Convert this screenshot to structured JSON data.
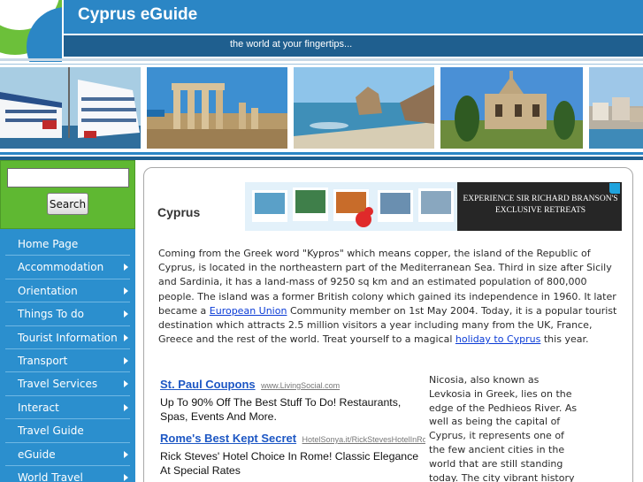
{
  "header": {
    "site_title": "Cyprus eGuide",
    "tagline": "the world at your fingertips..."
  },
  "photos": [
    {
      "subject": "cruise ships in harbour",
      "sky": "#a8cde3",
      "ground": "#2f6e9c"
    },
    {
      "subject": "ancient temple columns",
      "sky": "#3d8fd1",
      "ground": "#b79a6a"
    },
    {
      "subject": "rocky coast and sea",
      "sky": "#8ec4ea",
      "ground": "#3f8fb8"
    },
    {
      "subject": "abbey ruins with cypress trees",
      "sky": "#4a90d6",
      "ground": "#6c8b3c"
    },
    {
      "subject": "seaside town",
      "sky": "#9ec7e8",
      "ground": "#b8b0a2"
    }
  ],
  "sidebar": {
    "search": {
      "value": "",
      "placeholder": "",
      "button_label": "Search"
    },
    "nav": [
      {
        "label": "Home Page",
        "has_submenu": false
      },
      {
        "label": "Accommodation",
        "has_submenu": true
      },
      {
        "label": "Orientation",
        "has_submenu": true
      },
      {
        "label": "Things To do",
        "has_submenu": true
      },
      {
        "label": "Tourist Information",
        "has_submenu": true
      },
      {
        "label": "Transport",
        "has_submenu": true
      },
      {
        "label": "Travel Services",
        "has_submenu": true
      },
      {
        "label": "Interact",
        "has_submenu": true
      },
      {
        "label": "Travel Guide",
        "has_submenu": false
      },
      {
        "label": "eGuide",
        "has_submenu": true
      },
      {
        "label": "World Travel",
        "has_submenu": true
      }
    ]
  },
  "main": {
    "heading": "Cyprus",
    "banner_ad": {
      "text": "EXPERIENCE SIR RICHARD BRANSON'S EXCLUSIVE RETREATS"
    },
    "intro": {
      "part1": "Coming from the Greek word \"Kypros\" which means copper, the island of the Republic of Cyprus, is located in the northeastern part of the Mediterranean Sea. Third in size after Sicily and Sardinia, it has a land-mass of 9250 sq km and an estimated population of 800,000 people. The island was a former British colony which gained its independence in 1960. It later became a ",
      "link1": "European Union",
      "part2": " Community member on 1st May 2004. Today, it is a popular tourist destination which attracts 2.5 million visitors a year including many from the UK, France, Greece and the rest of the world. Treat yourself to a magical ",
      "link2": "holiday to Cyprus",
      "part3": " this year."
    },
    "ads": [
      {
        "title": "St. Paul Coupons",
        "url": "www.LivingSocial.com",
        "desc": "Up To 90% Off The Best Stuff To Do! Restaurants, Spas, Events And More."
      },
      {
        "title": "Rome's Best Kept Secret",
        "url": "HotelSonya.it/RickStevesHotelInRome",
        "desc": "Rick Steves' Hotel Choice In Rome! Classic Elegance At Special Rates"
      }
    ],
    "side_text": "Nicosia, also known as Levkosia in Greek, lies on the edge of the Pedhieos River. As well as being the capital of Cyprus, it represents one of the few ancient cities in the world that are still standing today. The city vibrant history dates back as far as the"
  }
}
